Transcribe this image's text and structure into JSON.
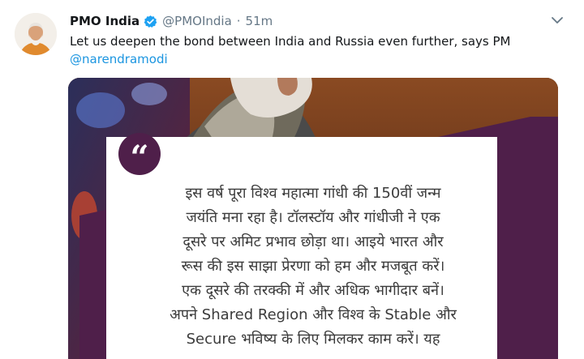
{
  "tweet": {
    "author_name": "PMO India",
    "handle": "@PMOIndia",
    "separator": "·",
    "time": "51m",
    "text_before": "Let us deepen the bond between India and Russia even further, says PM",
    "mention": "@narendramodi"
  },
  "quote_card": {
    "quote_mark": "“",
    "lines": [
      "इस वर्ष पूरा विश्व महात्मा गांधी की 150वीं जन्म",
      "जयंति मना रहा है। टॉलस्टॉय और गांधीजी ने एक",
      "दूसरे पर अमिट प्रभाव छोड़ा था। आइये भारत और",
      "रूस की इस साझा प्रेरणा को हम और मजबूत करें।",
      "एक दूसरे की तरक्की में और अधिक भागीदार बनें।",
      "अपने Shared Region और विश्व के Stable और",
      "Secure भविष्य के लिए मिलकर काम करें। यह"
    ],
    "accent_color": "#4f1f4a"
  },
  "icons": [
    "avatar",
    "verified-badge-icon",
    "chevron-down-icon",
    "quote-mark-icon"
  ],
  "colors": {
    "link": "#1b95e0",
    "muted": "#657786",
    "text": "#14171a"
  }
}
